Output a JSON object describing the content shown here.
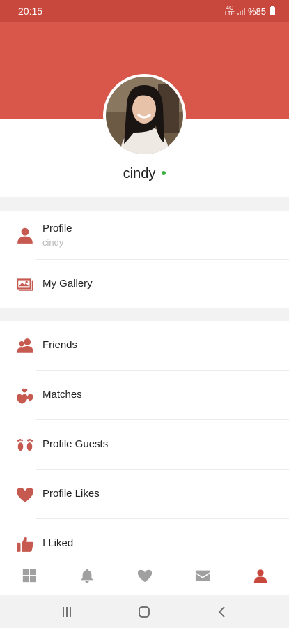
{
  "status_bar": {
    "time": "20:15",
    "network": "4G\nLTE",
    "battery": "%85"
  },
  "profile": {
    "username": "cindy",
    "online": true
  },
  "menu_section_1": [
    {
      "label": "Profile",
      "sub": "cindy",
      "icon": "person-icon"
    },
    {
      "label": "My Gallery",
      "icon": "gallery-icon"
    }
  ],
  "menu_section_2": [
    {
      "label": "Friends",
      "icon": "friends-icon"
    },
    {
      "label": "Matches",
      "icon": "matches-icon"
    },
    {
      "label": "Profile Guests",
      "icon": "footprints-icon"
    },
    {
      "label": "Profile Likes",
      "icon": "heart-icon"
    },
    {
      "label": "I Liked",
      "icon": "thumbs-up-icon"
    }
  ],
  "bottom_nav": [
    {
      "icon": "grid-icon",
      "active": false
    },
    {
      "icon": "bell-icon",
      "active": false
    },
    {
      "icon": "heart-icon",
      "active": false
    },
    {
      "icon": "mail-icon",
      "active": false
    },
    {
      "icon": "person-icon",
      "active": true
    }
  ],
  "colors": {
    "brand": "#d9564a",
    "brand_dark": "#c8483e",
    "icon": "#c65a50",
    "online": "#3cb043"
  }
}
